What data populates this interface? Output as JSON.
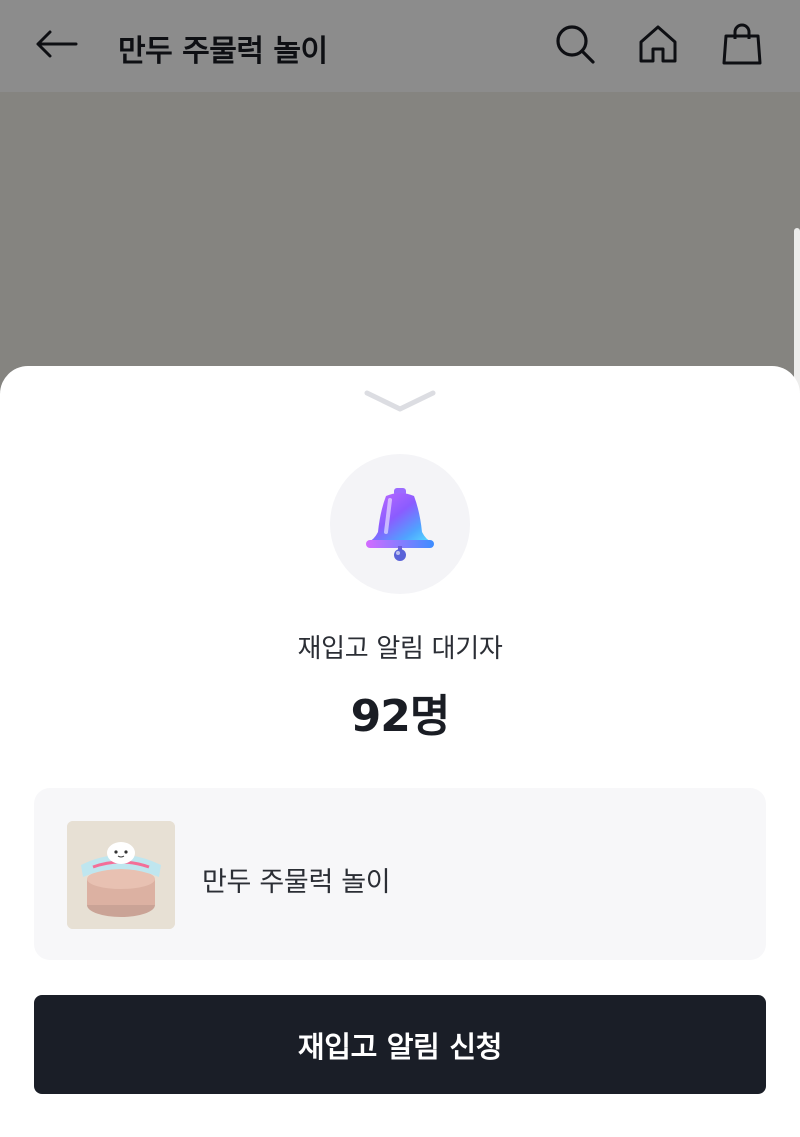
{
  "header": {
    "title": "만두 주물럭 놀이",
    "back_icon": "arrow-left-icon",
    "search_icon": "search-icon",
    "home_icon": "home-icon",
    "cart_icon": "shopping-bag-icon"
  },
  "sheet": {
    "handle_icon": "chevron-down-icon",
    "bell_icon": "bell-icon",
    "waiting_label": "재입고 알림 대기자",
    "waiting_count": "92명",
    "product": {
      "name": "만두 주물럭 놀이"
    },
    "cta_label": "재입고 알림 신청"
  },
  "colors": {
    "primary_button": "#1a1e27",
    "card_background": "#f7f7f9",
    "overlay": "rgba(0,0,0,0.45)"
  }
}
